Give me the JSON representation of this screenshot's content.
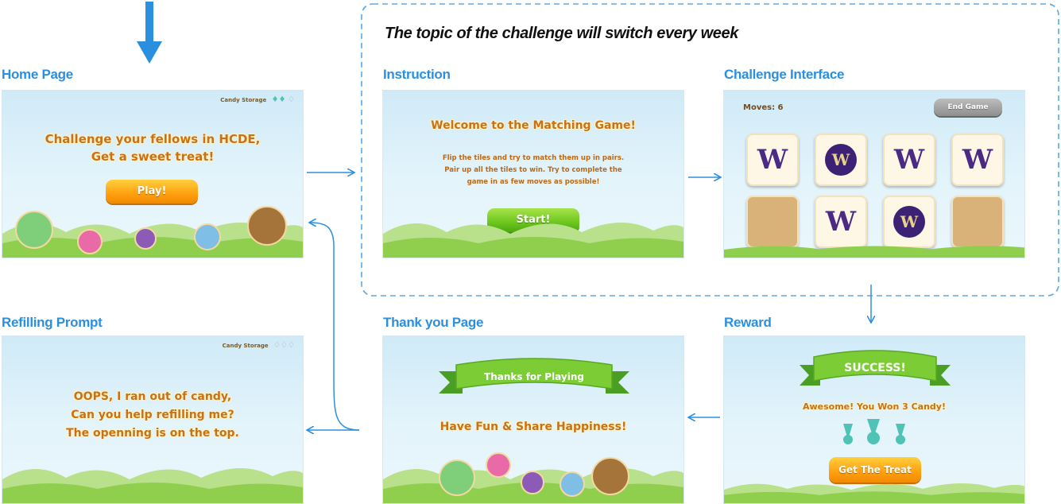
{
  "callout_title": "The topic of the challenge will switch every week",
  "panels": {
    "home": {
      "label": "Home Page",
      "storage": "Candy Storage",
      "headline_1": "Challenge your fellows in HCDE,",
      "headline_2": "Get a sweet treat!",
      "button": "Play!"
    },
    "instruction": {
      "label": "Instruction",
      "title": "Welcome to the Matching Game!",
      "body_1": "Flip the tiles and try to match them up in pairs.",
      "body_2": "Pair up all the tiles to win. Try to complete the",
      "body_3": "game in as few moves as possible!",
      "button": "Start!"
    },
    "challenge": {
      "label": "Challenge Interface",
      "moves": "Moves: 6",
      "button": "End Game",
      "tile_letter": "W"
    },
    "refill": {
      "label": "Refilling Prompt",
      "storage": "Candy Storage",
      "line_1": "OOPS, I ran out of candy,",
      "line_2": "Can you help refilling me?",
      "line_3": "The openning is on the top."
    },
    "thanks": {
      "label": "Thank you Page",
      "banner": "Thanks for Playing",
      "message": "Have Fun & Share Happiness!"
    },
    "reward": {
      "label": "Reward",
      "banner": "SUCCESS!",
      "message": "Awesome! You Won 3 Candy!",
      "button": "Get The Treat"
    }
  },
  "colors": {
    "label_blue": "#2b8fe0",
    "arrow_blue": "#2b8fe0",
    "text_orange": "#c8711a",
    "uw_purple": "#4b2a85"
  }
}
